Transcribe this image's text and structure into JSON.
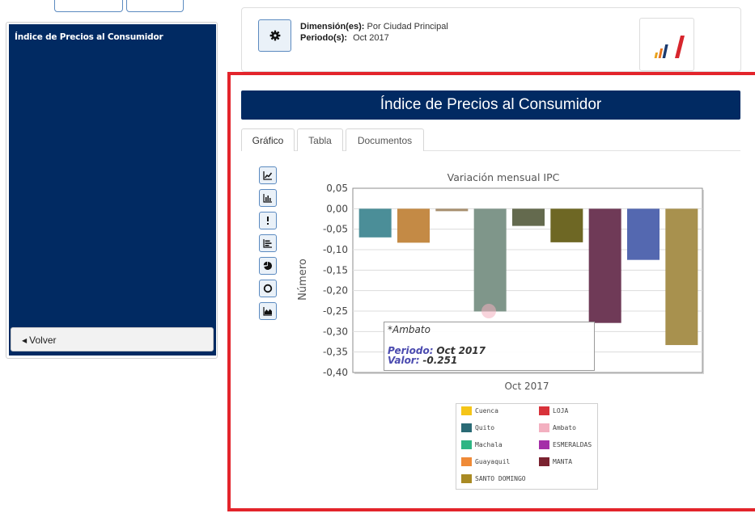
{
  "sidebar": {
    "title": "Índice de Precios al Consumidor",
    "back_label": "Volver"
  },
  "info": {
    "dimension_label": "Dimensión(es):",
    "dimension_value": "Por Ciudad Principal",
    "period_label": "Periodo(s):",
    "period_value": "Oct 2017"
  },
  "banner_title": "Índice de Precios al Consumidor",
  "tabs": [
    {
      "label": "Gráfico",
      "active": true
    },
    {
      "label": "Tabla",
      "active": false
    },
    {
      "label": "Documentos",
      "active": false
    }
  ],
  "chart_type_buttons": [
    "line-chart-icon",
    "bar-chart-icon",
    "dot-chart-icon",
    "horizontal-bar-icon",
    "pie-chart-icon",
    "donut-chart-icon",
    "area-chart-icon"
  ],
  "chart_data": {
    "type": "bar",
    "title": "Variación mensual IPC",
    "ylabel": "Número",
    "xlabel": "Oct 2017",
    "ylim": [
      -0.4,
      0.05
    ],
    "yticks": [
      "0,05",
      "0,00",
      "-0,05",
      "-0,10",
      "-0,15",
      "-0,20",
      "-0,25",
      "-0,30",
      "-0,35",
      "-0,40"
    ],
    "series": [
      {
        "name": "Cuenca",
        "value": -0.07,
        "color": "#4b8e98"
      },
      {
        "name": "Quito",
        "value": -0.083,
        "color": "#c48a45"
      },
      {
        "name": "Machala",
        "value": -0.006,
        "color": "#a89070"
      },
      {
        "name": "Ambato",
        "value": -0.251,
        "color": "#7f968a"
      },
      {
        "name": "Guayaquil",
        "value": -0.042,
        "color": "#646a4e"
      },
      {
        "name": "LOJA",
        "value": -0.082,
        "color": "#6e6724"
      },
      {
        "name": "MANTA",
        "value": -0.279,
        "color": "#6f3a57"
      },
      {
        "name": "ESMERALDAS",
        "value": -0.125,
        "color": "#5468b0"
      },
      {
        "name": "SANTO DOMINGO",
        "value": -0.333,
        "color": "#a8914e"
      }
    ],
    "legend": [
      {
        "name": "Cuenca",
        "color": "#f5c518"
      },
      {
        "name": "LOJA",
        "color": "#d8323a"
      },
      {
        "name": "Quito",
        "color": "#2a6a75"
      },
      {
        "name": "Ambato",
        "color": "#f3b0c0"
      },
      {
        "name": "Machala",
        "color": "#2fb584"
      },
      {
        "name": "ESMERALDAS",
        "color": "#a42fa8"
      },
      {
        "name": "Guayaquil",
        "color": "#ef8a37"
      },
      {
        "name": "MANTA",
        "color": "#7a2230"
      },
      {
        "name": "SANTO DOMINGO",
        "color": "#a98a23"
      }
    ]
  },
  "tooltip": {
    "title": "*Ambato",
    "period_label": "Periodo:",
    "period_value": "Oct 2017",
    "value_label": "Valor:",
    "value": "-0.251"
  }
}
